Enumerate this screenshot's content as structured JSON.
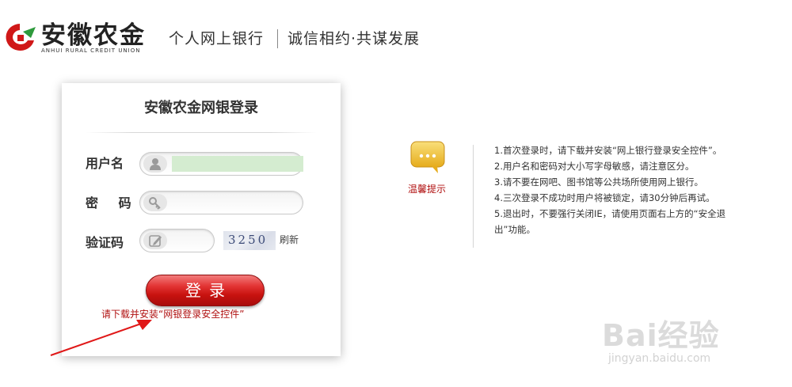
{
  "header": {
    "brand_name": "安徽农金",
    "brand_en": "ANHUI RURAL CREDIT UNION",
    "title": "个人网上银行",
    "slogan": "诚信相约·共谋发展"
  },
  "login": {
    "title": "安徽农金网银登录",
    "username_label": "用户名",
    "password_label": "密  码",
    "captcha_label": "验证码",
    "captcha_code": "3250",
    "refresh_label": "刷新",
    "submit_label": "登录",
    "control_hint": "请下载并安装“网银登录安全控件”"
  },
  "tips": {
    "label": "温馨提示",
    "items": [
      "1.首次登录时，请下载并安装“网上银行登录安全控件”。",
      "2.用户名和密码对大小写字母敏感，请注意区分。",
      "3.请不要在网吧、图书馆等公共场所使用网上银行。",
      "4.三次登录不成功时用户将被锁定，请30分钟后再试。",
      "5.退出时，不要强行关闭IE，请使用页面右上方的“安全退出”功能。"
    ]
  },
  "watermark": {
    "text": "Bai经验",
    "sub": "jingyan.baidu.com"
  },
  "colors": {
    "brand_red": "#c8120f",
    "hint_red": "#b01010",
    "username_fill": "#d4ecd0"
  },
  "icons": [
    "logo-mark",
    "user-icon",
    "key-icon",
    "edit-icon",
    "chat-bubble-icon",
    "annotation-arrow"
  ]
}
